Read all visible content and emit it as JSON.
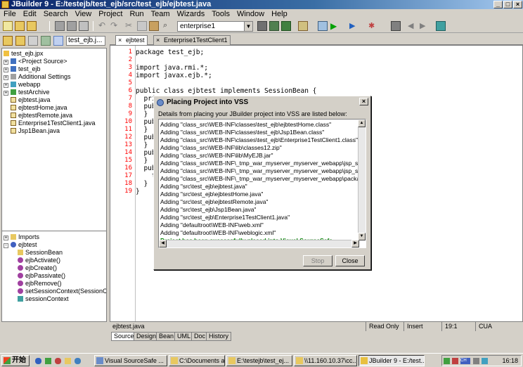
{
  "window": {
    "title": "JBuilder 9 - E:/testejb/test_ejb/src/test_ejb/ejbtest.java",
    "min": "_",
    "max": "□",
    "close": "×"
  },
  "menu": [
    "File",
    "Edit",
    "Search",
    "View",
    "Project",
    "Run",
    "Team",
    "Wizards",
    "Tools",
    "Window",
    "Help"
  ],
  "toolbar": {
    "combo_value": "enterprise1"
  },
  "project": {
    "combo": "test_ejb.j...",
    "tree": [
      {
        "label": "test_ejb.jpx",
        "icon": "project-icon",
        "expander": ""
      },
      {
        "label": "<Project Source>",
        "icon": "package-icon",
        "expander": "+"
      },
      {
        "label": "test_ejb",
        "icon": "package-icon",
        "expander": "+"
      },
      {
        "label": "Additional Settings",
        "icon": "settings-icon",
        "expander": "+"
      },
      {
        "label": "webapp",
        "icon": "webapp-icon",
        "expander": "+"
      },
      {
        "label": "testArchive",
        "icon": "archive-icon",
        "expander": "+"
      },
      {
        "label": "ejbtest.java",
        "icon": "java-file-icon",
        "expander": ""
      },
      {
        "label": "ejbtestHome.java",
        "icon": "java-file-icon",
        "expander": ""
      },
      {
        "label": "ejbtestRemote.java",
        "icon": "java-file-icon",
        "expander": ""
      },
      {
        "label": "Enterprise1TestClient1.java",
        "icon": "java-file-icon",
        "expander": ""
      },
      {
        "label": "Jsp1Bean.java",
        "icon": "java-file-icon",
        "expander": ""
      }
    ]
  },
  "structure": {
    "tree": [
      {
        "label": "Imports",
        "icon": "folder-icon",
        "expander": "+",
        "indent": 0
      },
      {
        "label": "ejbtest",
        "icon": "class-icon",
        "expander": "-",
        "indent": 0
      },
      {
        "label": "SessionBean",
        "icon": "interface-icon",
        "expander": "",
        "indent": 1
      },
      {
        "label": "ejbActivate()",
        "icon": "method-icon",
        "expander": "",
        "indent": 1
      },
      {
        "label": "ejbCreate()",
        "icon": "method-icon",
        "expander": "",
        "indent": 1
      },
      {
        "label": "ejbPassivate()",
        "icon": "method-icon",
        "expander": "",
        "indent": 1
      },
      {
        "label": "ejbRemove()",
        "icon": "method-icon",
        "expander": "",
        "indent": 1
      },
      {
        "label": "setSessionContext(SessionC",
        "icon": "method-icon",
        "expander": "",
        "indent": 1
      },
      {
        "label": "sessionContext",
        "icon": "field-icon",
        "expander": "",
        "indent": 1
      }
    ]
  },
  "editor": {
    "tabs": [
      "ejbtest",
      "Enterprise1TestClient1"
    ],
    "lines": [
      {
        "n": "1",
        "code": "package test_ejb;"
      },
      {
        "n": "2",
        "code": ""
      },
      {
        "n": "3",
        "code": "import java.rmi.*;"
      },
      {
        "n": "4",
        "code": "import javax.ejb.*;"
      },
      {
        "n": "5",
        "code": ""
      },
      {
        "n": "6",
        "code": "public class ejbtest implements SessionBean {"
      },
      {
        "n": "7",
        "code": "  pri"
      },
      {
        "n": "8",
        "code": "  pub"
      },
      {
        "n": "9",
        "code": "  }"
      },
      {
        "n": "10",
        "code": "  pub"
      },
      {
        "n": "11",
        "code": "  }"
      },
      {
        "n": "12",
        "code": "  pub"
      },
      {
        "n": "13",
        "code": "  }"
      },
      {
        "n": "14",
        "code": "  pub"
      },
      {
        "n": "15",
        "code": "  }"
      },
      {
        "n": "16",
        "code": "  pub"
      },
      {
        "n": "17",
        "code": "    t"
      },
      {
        "n": "18",
        "code": "  }"
      },
      {
        "n": "19",
        "code": "}"
      }
    ]
  },
  "status": {
    "file": "ejbtest.java",
    "mode": "Read Only",
    "insert": "Insert",
    "pos": "19:1",
    "keymap": "CUA"
  },
  "bottom_tabs": [
    "Source",
    "Design",
    "Bean",
    "UML",
    "Doc",
    "History"
  ],
  "dialog": {
    "title": "Placing Project into VSS",
    "message": "Details from placing your JBuilder project into VSS are listed below:",
    "log": [
      "Adding \"class_src\\WEB-INF\\classes\\test_ejb\\ejbtestHome.class\"",
      "Adding \"class_src\\WEB-INF\\classes\\test_ejb\\Jsp1Bean.class\"",
      "Adding \"class_src\\WEB-INF\\classes\\test_ejb\\Enterprise1TestClient1.class\"",
      "Adding \"class_src\\WEB-INF\\lib\\classes12.zip\"",
      "Adding \"class_src\\WEB-INF\\lib\\MyEJB.jar\"",
      "Adding \"class_src\\WEB-INF\\_tmp_war_myserver_myserver_webapp\\jsp_servle",
      "Adding \"class_src\\WEB-INF\\_tmp_war_myserver_myserver_webapp\\jsp_servle",
      "Adding \"class_src\\WEB-INF\\_tmp_war_myserver_myserver_webapp\\package.c",
      "Adding \"src\\test_ejb\\ejbtest.java\"",
      "Adding \"src\\test_ejb\\ejbtestHome.java\"",
      "Adding \"src\\test_ejb\\ejbtestRemote.java\"",
      "Adding \"src\\test_ejb\\Jsp1Bean.java\"",
      "Adding \"src\\test_ejb\\Enterprise1TestClient1.java\"",
      "Adding \"defaultroot\\WEB-INF\\web.xml\"",
      "Adding \"defaultroot\\WEB-INF\\weblogic.xml\""
    ],
    "success": "Project has been successfully placed into Visual SourceSafe.",
    "stop_label": "Stop",
    "close_label": "Close",
    "close_x": "×"
  },
  "taskbar": {
    "start": "开始",
    "tasks": [
      {
        "label": "Visual SourceSafe ...",
        "active": false
      },
      {
        "label": "C:\\Documents and...",
        "active": false
      },
      {
        "label": "E:\\testejb\\test_ej...",
        "active": false
      },
      {
        "label": "\\\\11.160.10.37\\cc...",
        "active": false
      },
      {
        "label": "JBuilder 9 - E:/test...",
        "active": true
      }
    ],
    "tray_text": "CH",
    "clock": "16:18"
  }
}
